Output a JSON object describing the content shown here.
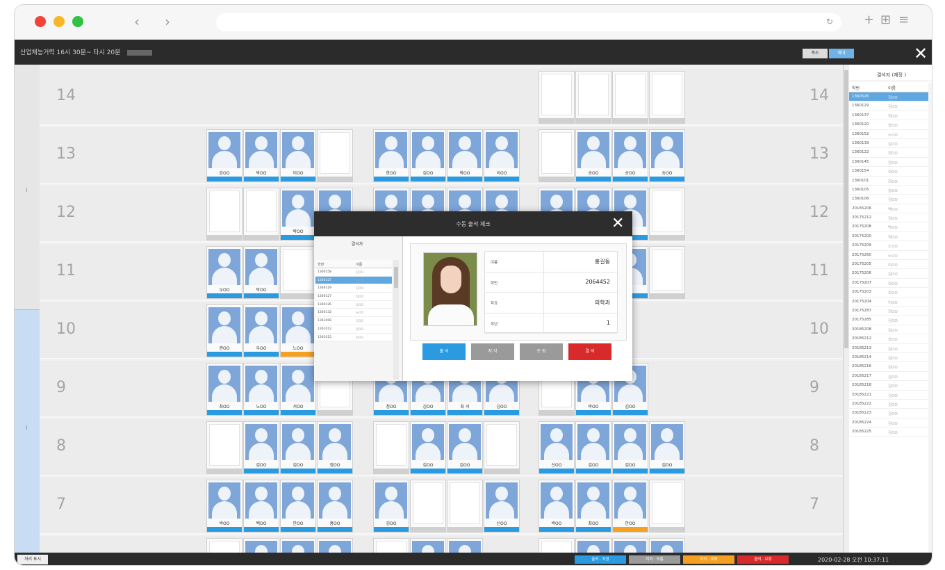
{
  "browser": {
    "back": "‹",
    "forward": "›",
    "reload": "↻",
    "new_tab": "+",
    "grid": "⊞",
    "menu": "≡"
  },
  "app": {
    "title": "산업체능거력  16시 30분~ 타시 20분",
    "btn_shrink": "축소",
    "btn_expand": "확대",
    "close": "✕"
  },
  "left_marks": [
    "I",
    "I"
  ],
  "rows": [
    {
      "num": "14",
      "seats": [
        {
          "g": 3,
          "i": 0,
          "t": "empty"
        },
        {
          "g": 3,
          "i": 1,
          "t": "empty"
        },
        {
          "g": 3,
          "i": 2,
          "t": "empty"
        },
        {
          "g": 3,
          "i": 3,
          "t": "empty"
        }
      ]
    },
    {
      "num": "13",
      "seats": [
        {
          "g": 1,
          "i": 0,
          "t": "blue",
          "n": "강OO"
        },
        {
          "g": 1,
          "i": 1,
          "t": "blue",
          "n": "박OO"
        },
        {
          "g": 1,
          "i": 2,
          "t": "blue",
          "n": "이OO"
        },
        {
          "g": 1,
          "i": 3,
          "t": "empty"
        },
        {
          "g": 2,
          "i": 0,
          "t": "blue",
          "n": "한OO"
        },
        {
          "g": 2,
          "i": 1,
          "t": "blue",
          "n": "김OO"
        },
        {
          "g": 2,
          "i": 2,
          "t": "blue",
          "n": "박OO"
        },
        {
          "g": 2,
          "i": 3,
          "t": "blue",
          "n": "이OO"
        },
        {
          "g": 3,
          "i": 0,
          "t": "empty"
        },
        {
          "g": 3,
          "i": 1,
          "t": "blue",
          "n": "송OO"
        },
        {
          "g": 3,
          "i": 2,
          "t": "blue",
          "n": "송OO"
        },
        {
          "g": 3,
          "i": 3,
          "t": "blue",
          "n": "송OO"
        }
      ]
    },
    {
      "num": "12",
      "seats": [
        {
          "g": 1,
          "i": 0,
          "t": "empty"
        },
        {
          "g": 1,
          "i": 1,
          "t": "empty"
        },
        {
          "g": 1,
          "i": 2,
          "t": "blue",
          "n": "박OO"
        },
        {
          "g": 1,
          "i": 3,
          "t": "blue",
          "n": ""
        },
        {
          "g": 2,
          "i": 0,
          "t": "blue",
          "n": ""
        },
        {
          "g": 2,
          "i": 1,
          "t": "blue",
          "n": ""
        },
        {
          "g": 2,
          "i": 2,
          "t": "blue",
          "n": ""
        },
        {
          "g": 2,
          "i": 3,
          "t": "blue",
          "n": ""
        },
        {
          "g": 3,
          "i": 0,
          "t": "blue",
          "n": ""
        },
        {
          "g": 3,
          "i": 1,
          "t": "blue",
          "n": ""
        },
        {
          "g": 3,
          "i": 2,
          "t": "blue",
          "n": ""
        },
        {
          "g": 3,
          "i": 3,
          "t": "empty"
        }
      ]
    },
    {
      "num": "11",
      "seats": [
        {
          "g": 1,
          "i": 0,
          "t": "blue",
          "n": "우OO"
        },
        {
          "g": 1,
          "i": 1,
          "t": "blue",
          "n": "박OO"
        },
        {
          "g": 1,
          "i": 2,
          "t": "empty"
        },
        {
          "g": 3,
          "i": 2,
          "t": "blue",
          "n": ""
        },
        {
          "g": 3,
          "i": 3,
          "t": "empty"
        }
      ]
    },
    {
      "num": "10",
      "seats": [
        {
          "g": 1,
          "i": 0,
          "t": "blue",
          "n": "권OO"
        },
        {
          "g": 1,
          "i": 1,
          "t": "blue",
          "n": "우OO"
        },
        {
          "g": 1,
          "i": 2,
          "t": "orange",
          "n": "노OO"
        }
      ]
    },
    {
      "num": "9",
      "seats": [
        {
          "g": 1,
          "i": 0,
          "t": "blue",
          "n": "최OO"
        },
        {
          "g": 1,
          "i": 1,
          "t": "blue",
          "n": "노OO"
        },
        {
          "g": 1,
          "i": 2,
          "t": "blue",
          "n": "서OO"
        },
        {
          "g": 1,
          "i": 3,
          "t": "empty"
        },
        {
          "g": 2,
          "i": 0,
          "t": "blue",
          "n": "정OO"
        },
        {
          "g": 2,
          "i": 1,
          "t": "blue",
          "n": "김OO"
        },
        {
          "g": 2,
          "i": 2,
          "t": "blue",
          "n": "최 서"
        },
        {
          "g": 2,
          "i": 3,
          "t": "blue",
          "n": "김OO"
        },
        {
          "g": 3,
          "i": 0,
          "t": "empty"
        },
        {
          "g": 3,
          "i": 1,
          "t": "blue",
          "n": "박OO"
        },
        {
          "g": 3,
          "i": 2,
          "t": "blue",
          "n": "김OO"
        }
      ]
    },
    {
      "num": "8",
      "seats": [
        {
          "g": 1,
          "i": 0,
          "t": "empty"
        },
        {
          "g": 1,
          "i": 1,
          "t": "blue",
          "n": "김OO"
        },
        {
          "g": 1,
          "i": 2,
          "t": "blue",
          "n": "김OO"
        },
        {
          "g": 1,
          "i": 3,
          "t": "blue",
          "n": "정OO"
        },
        {
          "g": 2,
          "i": 0,
          "t": "empty"
        },
        {
          "g": 2,
          "i": 1,
          "t": "blue",
          "n": "김OO"
        },
        {
          "g": 2,
          "i": 2,
          "t": "blue",
          "n": "김OO"
        },
        {
          "g": 2,
          "i": 3,
          "t": "empty"
        },
        {
          "g": 3,
          "i": 0,
          "t": "blue",
          "n": "신OO"
        },
        {
          "g": 3,
          "i": 1,
          "t": "blue",
          "n": "김OO"
        },
        {
          "g": 3,
          "i": 2,
          "t": "blue",
          "n": "김OO"
        },
        {
          "g": 3,
          "i": 3,
          "t": "blue",
          "n": "김OO"
        }
      ]
    },
    {
      "num": "7",
      "seats": [
        {
          "g": 1,
          "i": 0,
          "t": "blue",
          "n": "박OO"
        },
        {
          "g": 1,
          "i": 1,
          "t": "blue",
          "n": "백OO"
        },
        {
          "g": 1,
          "i": 2,
          "t": "blue",
          "n": "안OO"
        },
        {
          "g": 1,
          "i": 3,
          "t": "blue",
          "n": "홍OO"
        },
        {
          "g": 2,
          "i": 0,
          "t": "blue",
          "n": "김OO"
        },
        {
          "g": 2,
          "i": 1,
          "t": "empty"
        },
        {
          "g": 2,
          "i": 2,
          "t": "empty"
        },
        {
          "g": 2,
          "i": 3,
          "t": "blue",
          "n": "신OO"
        },
        {
          "g": 3,
          "i": 0,
          "t": "blue",
          "n": "박OO"
        },
        {
          "g": 3,
          "i": 1,
          "t": "blue",
          "n": "최OO"
        },
        {
          "g": 3,
          "i": 2,
          "t": "orange",
          "n": "안OO"
        },
        {
          "g": 3,
          "i": 3,
          "t": "empty"
        }
      ]
    },
    {
      "num": "",
      "seats": [
        {
          "g": 1,
          "i": 0,
          "t": "empty"
        },
        {
          "g": 1,
          "i": 1,
          "t": "blue",
          "n": ""
        },
        {
          "g": 1,
          "i": 2,
          "t": "blue",
          "n": ""
        },
        {
          "g": 1,
          "i": 3,
          "t": "blue",
          "n": ""
        },
        {
          "g": 2,
          "i": 0,
          "t": "empty"
        },
        {
          "g": 2,
          "i": 1,
          "t": "blue",
          "n": ""
        },
        {
          "g": 2,
          "i": 2,
          "t": "blue",
          "n": ""
        },
        {
          "g": 3,
          "i": 0,
          "t": "empty"
        },
        {
          "g": 3,
          "i": 1,
          "t": "blue",
          "n": ""
        },
        {
          "g": 3,
          "i": 2,
          "t": "blue",
          "n": ""
        },
        {
          "g": 3,
          "i": 3,
          "t": "blue",
          "n": ""
        }
      ]
    }
  ],
  "right_panel": {
    "title": "결석자 (재정 )",
    "col_id": "학번",
    "col_name": "이름",
    "items": [
      {
        "id": "1360526",
        "name": "김OO",
        "sel": true
      },
      {
        "id": "1360129",
        "name": "김OO"
      },
      {
        "id": "1360137",
        "name": "최OO"
      },
      {
        "id": "1360120",
        "name": "송OO"
      },
      {
        "id": "1360152",
        "name": "노OO"
      },
      {
        "id": "1360139",
        "name": "김OO"
      },
      {
        "id": "1360122",
        "name": "정OO"
      },
      {
        "id": "1360145",
        "name": "정OO"
      },
      {
        "id": "1360154",
        "name": "최OO"
      },
      {
        "id": "1360101",
        "name": "최OO"
      },
      {
        "id": "1360105",
        "name": "송OO"
      },
      {
        "id": "1360106",
        "name": "김OO"
      },
      {
        "id": "20165206",
        "name": "백OO"
      },
      {
        "id": "20175212",
        "name": "김OO"
      },
      {
        "id": "20175208",
        "name": "박OO"
      },
      {
        "id": "20175200",
        "name": "최OO"
      },
      {
        "id": "20175209",
        "name": "노OO"
      },
      {
        "id": "20175260",
        "name": "노OO"
      },
      {
        "id": "20175205",
        "name": "이OO"
      },
      {
        "id": "20175206",
        "name": "김OO"
      },
      {
        "id": "20175207",
        "name": "최OO"
      },
      {
        "id": "20175203",
        "name": "최OO"
      },
      {
        "id": "20175204",
        "name": "이OO"
      },
      {
        "id": "20175287",
        "name": "최OO"
      },
      {
        "id": "20175285",
        "name": "김OO"
      },
      {
        "id": "20185208",
        "name": "김OO"
      },
      {
        "id": "20185212",
        "name": "송OO"
      },
      {
        "id": "20185213",
        "name": "김OO"
      },
      {
        "id": "20185214",
        "name": "김OO"
      },
      {
        "id": "20185216",
        "name": "김OO"
      },
      {
        "id": "20185217",
        "name": "김OO"
      },
      {
        "id": "20185218",
        "name": "김OO"
      },
      {
        "id": "20185221",
        "name": "김OO"
      },
      {
        "id": "20185222",
        "name": "김OO"
      },
      {
        "id": "20185223",
        "name": "김OO"
      },
      {
        "id": "20185224",
        "name": "김OO"
      },
      {
        "id": "20185225",
        "name": "김OO"
      }
    ]
  },
  "bottom": {
    "left_btn": "처리 표시",
    "legend": [
      {
        "label": "출석 · 지정",
        "color": "#2a9be0"
      },
      {
        "label": "미처 · 모름",
        "color": "#9a9a9a"
      },
      {
        "label": "지각 · 조퇴",
        "color": "#f5a020"
      },
      {
        "label": "결석 · 보류",
        "color": "#d82a2a"
      }
    ],
    "datetime": "2020-02-28  오전  10:37:11"
  },
  "modal": {
    "title": "수동 출석 체크",
    "close": "✕",
    "list_title": "결석자",
    "col_id": "학번",
    "col_name": "이름",
    "items": [
      {
        "id": "1360158",
        "name": "김OO"
      },
      {
        "id": "1360127",
        "name": "최OO",
        "sel": true
      },
      {
        "id": "1360129",
        "name": "김OO"
      },
      {
        "id": "1360127",
        "name": "최OO"
      },
      {
        "id": "1360126",
        "name": "송OO"
      },
      {
        "id": "1360132",
        "name": "노OO"
      },
      {
        "id": "1361008",
        "name": "김OO"
      },
      {
        "id": "1361012",
        "name": "정OO"
      },
      {
        "id": "1361015",
        "name": "최OO"
      }
    ],
    "fields": [
      {
        "key": "이름",
        "value": "홍길동"
      },
      {
        "key": "학번",
        "value": "2064452"
      },
      {
        "key": "학과",
        "value": "의학과"
      },
      {
        "key": "학년",
        "value": "1"
      }
    ],
    "buttons": [
      {
        "label": "출 석",
        "color": "#2a9be0"
      },
      {
        "label": "지 각",
        "color": "#9a9a9a"
      },
      {
        "label": "조 퇴",
        "color": "#9a9a9a"
      },
      {
        "label": "결 석",
        "color": "#d82a2a"
      }
    ]
  }
}
